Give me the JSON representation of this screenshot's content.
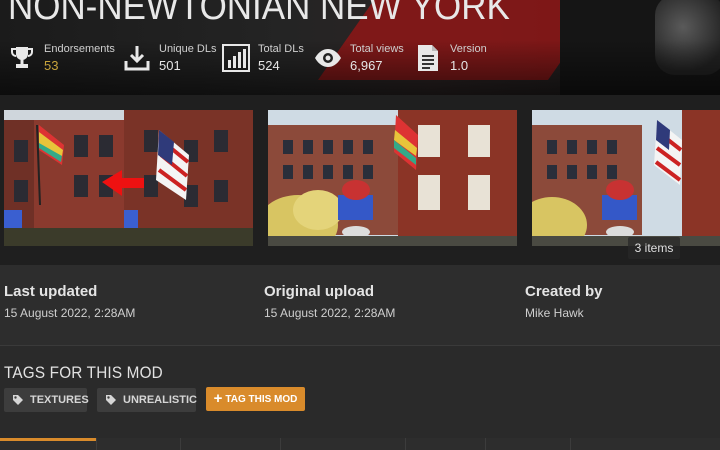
{
  "header": {
    "title": "NON-NEWTONIAN NEW YORK",
    "stats": [
      {
        "icon": "trophy-icon",
        "label": "Endorsements",
        "value": "53"
      },
      {
        "icon": "download-icon",
        "label": "Unique DLs",
        "value": "501"
      },
      {
        "icon": "bar-chart-icon",
        "label": "Total DLs",
        "value": "524"
      },
      {
        "icon": "eye-icon",
        "label": "Total views",
        "value": "6,967"
      },
      {
        "icon": "document-icon",
        "label": "Version",
        "value": "1.0"
      }
    ]
  },
  "gallery": {
    "count_label": "3 items"
  },
  "meta": {
    "last_updated_label": "Last updated",
    "last_updated_value": "15 August 2022,  2:28AM",
    "original_upload_label": "Original upload",
    "original_upload_value": "15 August 2022,  2:28AM",
    "created_by_label": "Created by",
    "created_by_value": "Mike Hawk"
  },
  "tags": {
    "heading": "TAGS FOR THIS MOD",
    "items": [
      "TEXTURES",
      "UNREALISTIC"
    ],
    "add_button": "TAG THIS MOD"
  },
  "colors": {
    "accent": "#d98b2b",
    "endorse_gold": "#c7a33b",
    "background": "#2a2a2a"
  }
}
